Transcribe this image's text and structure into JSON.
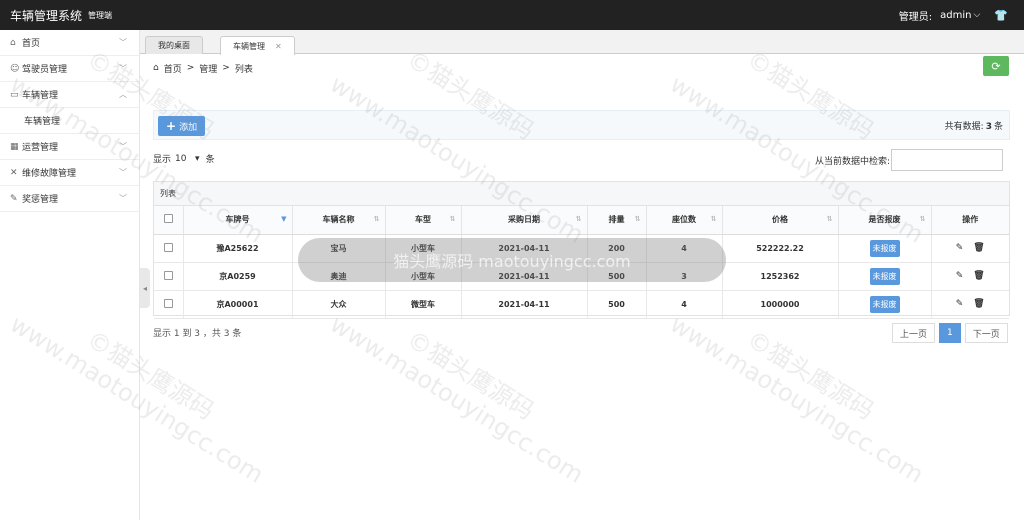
{
  "header": {
    "title": "车辆管理系统",
    "subtitle": "管理端",
    "role_label": "管理员:",
    "username": "admin"
  },
  "sidebar": {
    "items": [
      {
        "label": "首页",
        "icon": "home-icon"
      },
      {
        "label": "驾驶员管理",
        "icon": "user-icon"
      },
      {
        "label": "车辆管理",
        "icon": "car-icon",
        "children": [
          "车辆管理"
        ]
      },
      {
        "label": "运营管理",
        "icon": "calendar-icon"
      },
      {
        "label": "维修故障管理",
        "icon": "wrench-icon"
      },
      {
        "label": "奖惩管理",
        "icon": "edit-icon"
      }
    ]
  },
  "tabs": [
    {
      "label": "我的桌面"
    },
    {
      "label": "车辆管理"
    }
  ],
  "breadcrumb": [
    "首页",
    "管理",
    "列表"
  ],
  "toolbar": {
    "add_label": "添加",
    "total_prefix": "共有数据:",
    "total_count": "3",
    "total_suffix": "条"
  },
  "length": {
    "prefix": "显示",
    "value": "10",
    "suffix": "条"
  },
  "search": {
    "label": "从当前数据中检索:"
  },
  "panel": {
    "title": "列表"
  },
  "table": {
    "columns": [
      "车牌号",
      "车辆名称",
      "车型",
      "采购日期",
      "排量",
      "座位数",
      "价格",
      "是否报废",
      "操作"
    ],
    "rows": [
      [
        "豫A25622",
        "宝马",
        "小型车",
        "2021-04-11",
        "200",
        "4",
        "522222.22",
        "未报废"
      ],
      [
        "京A0259",
        "奥迪",
        "小型车",
        "2021-04-11",
        "500",
        "3",
        "1252362",
        "未报废"
      ],
      [
        "京A00001",
        "大众",
        "微型车",
        "2021-04-11",
        "500",
        "4",
        "1000000",
        "未报废"
      ]
    ]
  },
  "footer": {
    "info": "显示 1 到 3 ，共 3 条"
  },
  "pagination": {
    "prev": "上一页",
    "current": "1",
    "next": "下一页"
  },
  "watermark": {
    "text_cn": "©猫头鹰源码",
    "text_url": "www.maotouyingcc.com",
    "pill": "猫头鹰源码 maotouyingcc.com"
  }
}
